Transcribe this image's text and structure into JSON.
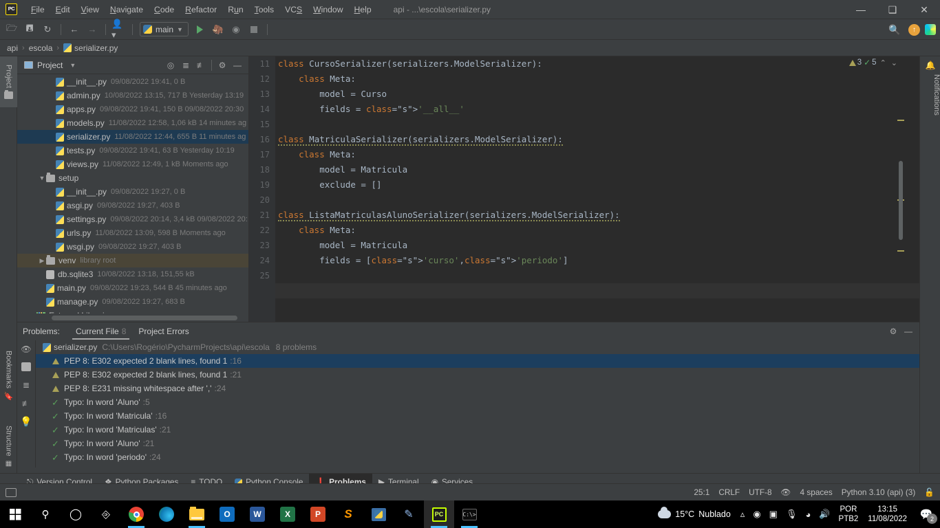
{
  "window": {
    "title": "api - ...\\escola\\serializer.py",
    "menu": [
      "File",
      "Edit",
      "View",
      "Navigate",
      "Code",
      "Refactor",
      "Run",
      "Tools",
      "VCS",
      "Window",
      "Help"
    ],
    "controls": {
      "minimize": "—",
      "maximize": "❐",
      "close": "✕"
    }
  },
  "toolbar": {
    "run_config": "main",
    "icons": [
      "open-folder-icon",
      "save-icon",
      "sync-icon",
      "back-arrow-icon",
      "forward-arrow-icon",
      "user-dropdown-icon"
    ],
    "search_icon": "search-icon",
    "update_icon": "update-icon",
    "ide_icon": "ide-services-icon"
  },
  "breadcrumb": {
    "items": [
      "api",
      "escola",
      "serializer.py"
    ],
    "separator": "›"
  },
  "left_strip": {
    "project_tab": "Project",
    "bookmarks_tab": "Bookmarks",
    "structure_tab": "Structure"
  },
  "right_strip": {
    "notifications_tab": "Notifications"
  },
  "project_panel": {
    "title": "Project",
    "header_icons": [
      "locate-icon",
      "expand-all-icon",
      "collapse-all-icon",
      "settings-gear-icon",
      "hide-icon"
    ],
    "tree": [
      {
        "name": "__init__.py",
        "meta": "09/08/2022 19:41, 0 B",
        "indent": 3,
        "icon": "python-file-icon",
        "state": "none"
      },
      {
        "name": "admin.py",
        "meta": "10/08/2022 13:15, 717 B Yesterday 13:19",
        "indent": 3,
        "icon": "python-file-icon",
        "state": "none"
      },
      {
        "name": "apps.py",
        "meta": "09/08/2022 19:41, 150 B 09/08/2022 20:30",
        "indent": 3,
        "icon": "python-file-icon",
        "state": "none"
      },
      {
        "name": "models.py",
        "meta": "11/08/2022 12:58, 1,06 kB 14 minutes ag",
        "indent": 3,
        "icon": "python-file-icon",
        "state": "none"
      },
      {
        "name": "serializer.py",
        "meta": "11/08/2022 12:44, 655 B 11 minutes ag",
        "indent": 3,
        "icon": "python-file-icon",
        "state": "selected"
      },
      {
        "name": "tests.py",
        "meta": "09/08/2022 19:41, 63 B Yesterday 10:19",
        "indent": 3,
        "icon": "python-file-icon",
        "state": "none"
      },
      {
        "name": "views.py",
        "meta": "11/08/2022 12:49, 1 kB Moments ago",
        "indent": 3,
        "icon": "python-file-icon",
        "state": "none"
      },
      {
        "name": "setup",
        "meta": "",
        "indent": 2,
        "icon": "folder-icon",
        "arrow": "v",
        "state": "none"
      },
      {
        "name": "__init__.py",
        "meta": "09/08/2022 19:27, 0 B",
        "indent": 3,
        "icon": "python-file-icon",
        "state": "none"
      },
      {
        "name": "asgi.py",
        "meta": "09/08/2022 19:27, 403 B",
        "indent": 3,
        "icon": "python-file-icon",
        "state": "none"
      },
      {
        "name": "settings.py",
        "meta": "09/08/2022 20:14, 3,4 kB 09/08/2022 20:",
        "indent": 3,
        "icon": "python-file-icon",
        "state": "none"
      },
      {
        "name": "urls.py",
        "meta": "11/08/2022 13:09, 598 B Moments ago",
        "indent": 3,
        "icon": "python-file-icon",
        "state": "none"
      },
      {
        "name": "wsgi.py",
        "meta": "09/08/2022 19:27, 403 B",
        "indent": 3,
        "icon": "python-file-icon",
        "state": "none"
      },
      {
        "name": "venv",
        "meta": "library root",
        "indent": 2,
        "icon": "folder-icon",
        "arrow": ">",
        "state": "venv"
      },
      {
        "name": "db.sqlite3",
        "meta": "10/08/2022 13:18, 151,55 kB",
        "indent": 2,
        "icon": "sqlite-file-icon",
        "state": "none"
      },
      {
        "name": "main.py",
        "meta": "09/08/2022 19:23, 544 B 45 minutes ago",
        "indent": 2,
        "icon": "python-file-icon",
        "state": "none"
      },
      {
        "name": "manage.py",
        "meta": "09/08/2022 19:27, 683 B",
        "indent": 2,
        "icon": "python-file-icon",
        "state": "none"
      },
      {
        "name": "External Libraries",
        "meta": "",
        "indent": 1,
        "icon": "libraries-icon",
        "arrow": ">",
        "state": "none"
      }
    ]
  },
  "editor": {
    "first_line_number": 11,
    "lines": [
      {
        "n": 11,
        "text": "class CursoSerializer(serializers.ModelSerializer):"
      },
      {
        "n": 12,
        "text": "    class Meta:"
      },
      {
        "n": 13,
        "text": "        model = Curso"
      },
      {
        "n": 14,
        "text": "        fields = '__all__'"
      },
      {
        "n": 15,
        "text": ""
      },
      {
        "n": 16,
        "text": "class MatriculaSerializer(serializers.ModelSerializer):"
      },
      {
        "n": 17,
        "text": "    class Meta:"
      },
      {
        "n": 18,
        "text": "        model = Matricula"
      },
      {
        "n": 19,
        "text": "        exclude = []"
      },
      {
        "n": 20,
        "text": ""
      },
      {
        "n": 21,
        "text": "class ListaMatriculasAlunoSerializer(serializers.ModelSerializer):"
      },
      {
        "n": 22,
        "text": "    class Meta:"
      },
      {
        "n": 23,
        "text": "        model = Matricula"
      },
      {
        "n": 24,
        "text": "        fields = ['curso','periodo']"
      },
      {
        "n": 25,
        "text": ""
      }
    ],
    "inspection": {
      "warnings": "3",
      "typos": "5",
      "up": "⌃",
      "down": "⌄"
    }
  },
  "problems_panel": {
    "label": "Problems:",
    "tabs": [
      {
        "label": "Current File",
        "count": "8",
        "selected": true
      },
      {
        "label": "Project Errors",
        "count": "",
        "selected": false
      }
    ],
    "header_icons": [
      "settings-gear-icon",
      "hide-icon"
    ],
    "side_icons": [
      "preview-icon",
      "open-editor-icon",
      "expand-all-icon",
      "collapse-all-icon",
      "quickfix-bulb-icon"
    ],
    "file_row": {
      "name": "serializer.py",
      "path": "C:\\Users\\Rogério\\PycharmProjects\\api\\escola",
      "count": "8 problems"
    },
    "items": [
      {
        "kind": "warning",
        "text": "PEP 8: E302 expected 2 blank lines, found 1",
        "line": ":16",
        "selected": true
      },
      {
        "kind": "warning",
        "text": "PEP 8: E302 expected 2 blank lines, found 1",
        "line": ":21",
        "selected": false
      },
      {
        "kind": "warning",
        "text": "PEP 8: E231 missing whitespace after ','",
        "line": ":24",
        "selected": false
      },
      {
        "kind": "typo",
        "text": "Typo: In word 'Aluno'",
        "line": ":5",
        "selected": false
      },
      {
        "kind": "typo",
        "text": "Typo: In word 'Matricula'",
        "line": ":16",
        "selected": false
      },
      {
        "kind": "typo",
        "text": "Typo: In word 'Matriculas'",
        "line": ":21",
        "selected": false
      },
      {
        "kind": "typo",
        "text": "Typo: In word 'Aluno'",
        "line": ":21",
        "selected": false
      },
      {
        "kind": "typo",
        "text": "Typo: In word 'periodo'",
        "line": ":24",
        "selected": false
      }
    ]
  },
  "bottom_tabs": [
    {
      "label": "Version Control",
      "icon": "branch-icon",
      "selected": false
    },
    {
      "label": "Python Packages",
      "icon": "packages-icon",
      "selected": false
    },
    {
      "label": "TODO",
      "icon": "todo-list-icon",
      "selected": false
    },
    {
      "label": "Python Console",
      "icon": "python-icon",
      "selected": false
    },
    {
      "label": "Problems",
      "icon": "problems-icon",
      "selected": true
    },
    {
      "label": "Terminal",
      "icon": "terminal-icon",
      "selected": false
    },
    {
      "label": "Services",
      "icon": "services-icon",
      "selected": false
    }
  ],
  "status_bar": {
    "caret": "25:1",
    "line_separator": "CRLF",
    "encoding": "UTF-8",
    "read_only_icon": "eye-icon",
    "indent": "4 spaces",
    "interpreter": "Python 3.10 (api) (3)",
    "lock_icon": "lock-icon"
  },
  "taskbar": {
    "apps": [
      {
        "name": "start-windows-icon",
        "label": ""
      },
      {
        "name": "search-icon",
        "label": ""
      },
      {
        "name": "cortana-icon",
        "label": ""
      },
      {
        "name": "task-view-icon",
        "label": ""
      },
      {
        "name": "chrome-icon",
        "label": ""
      },
      {
        "name": "edge-icon",
        "label": ""
      },
      {
        "name": "file-explorer-icon",
        "label": ""
      },
      {
        "name": "outlook-icon",
        "label": "O"
      },
      {
        "name": "word-icon",
        "label": "W"
      },
      {
        "name": "excel-icon",
        "label": "X"
      },
      {
        "name": "powerpoint-icon",
        "label": "P"
      },
      {
        "name": "sublime-icon",
        "label": "S"
      },
      {
        "name": "thonny-icon",
        "label": ""
      },
      {
        "name": "snipping-tool-icon",
        "label": ""
      },
      {
        "name": "pycharm-icon",
        "label": "PC"
      },
      {
        "name": "command-prompt-icon",
        "label": ""
      }
    ],
    "weather": {
      "temp": "15°C",
      "condition": "Nublado"
    },
    "tray_icons": [
      "show-hidden-icons-chevron",
      "record-icon",
      "camera-icon",
      "mic-off-icon",
      "wifi-icon",
      "volume-icon"
    ],
    "language": {
      "line1": "POR",
      "line2": "PTB2"
    },
    "clock": {
      "time": "13:15",
      "date": "11/08/2022"
    },
    "notification_count": "2"
  }
}
